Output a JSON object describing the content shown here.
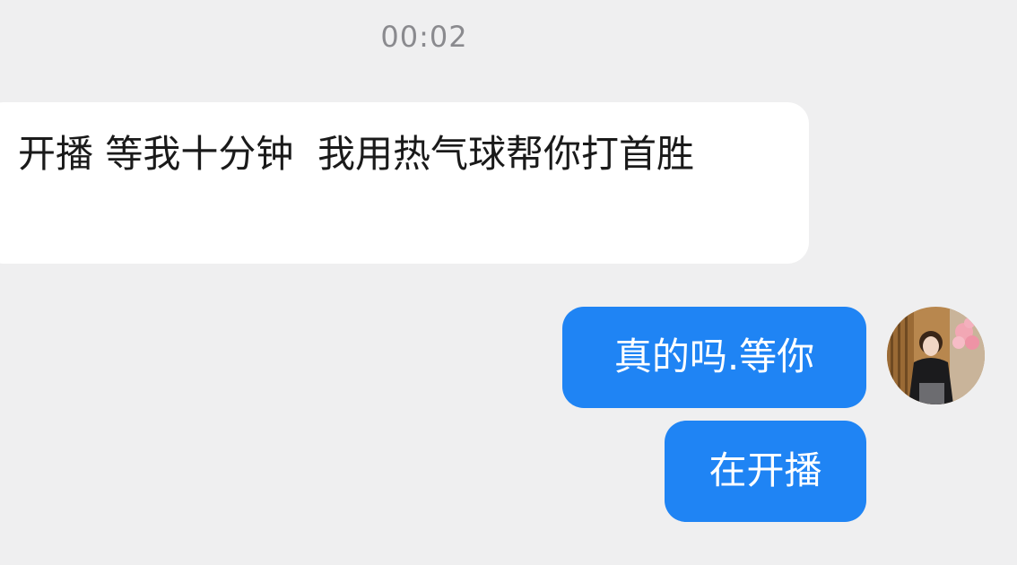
{
  "chat": {
    "timestamp": "00:02",
    "messages": [
      {
        "sender": "other",
        "text": "开播 等我十分钟  我用热气球帮你打首胜"
      },
      {
        "sender": "self",
        "text": "真的吗.等你"
      },
      {
        "sender": "self",
        "text": "在开播"
      }
    ]
  },
  "colors": {
    "background": "#efeff0",
    "incoming_bubble": "#ffffff",
    "outgoing_bubble": "#1f84f4",
    "timestamp_text": "#8a8a8e"
  },
  "icons": {
    "avatar": "user-avatar-photo"
  }
}
